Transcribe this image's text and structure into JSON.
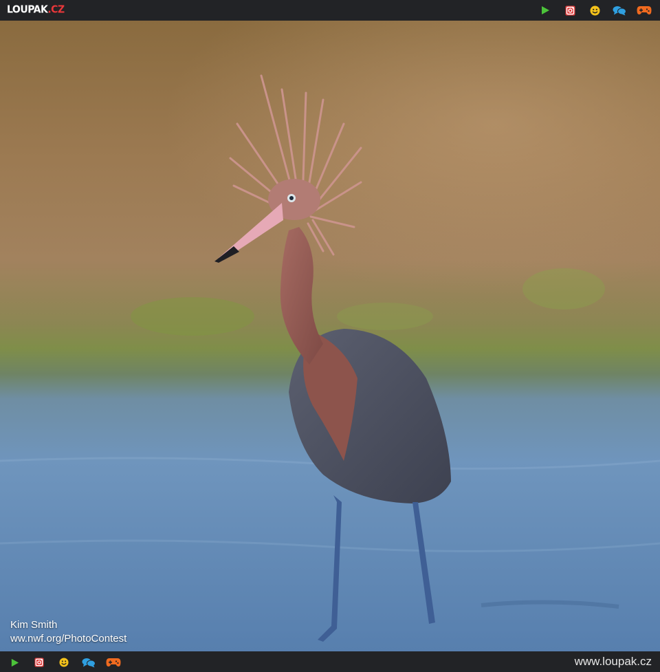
{
  "header": {
    "logo_main": "LOUPAK",
    "logo_tld": ".CZ",
    "icons": [
      "play-icon",
      "instagram-icon",
      "smiley-icon",
      "chat-icon",
      "gamepad-icon"
    ]
  },
  "photo": {
    "subject": "reddish-egret",
    "credit_name": "Kim Smith",
    "credit_source": "ww.nwf.org/PhotoContest"
  },
  "footer": {
    "icons": [
      "play-icon",
      "instagram-icon",
      "smiley-icon",
      "chat-icon",
      "gamepad-icon"
    ],
    "site_url": "www.loupak.cz"
  },
  "colors": {
    "bar": "#222326",
    "play": "#4cc33a",
    "instagram": "#e23b3b",
    "smiley": "#f4c21b",
    "chat": "#2f9fe0",
    "gamepad": "#f06a1f",
    "logo_accent": "#e8373a"
  }
}
